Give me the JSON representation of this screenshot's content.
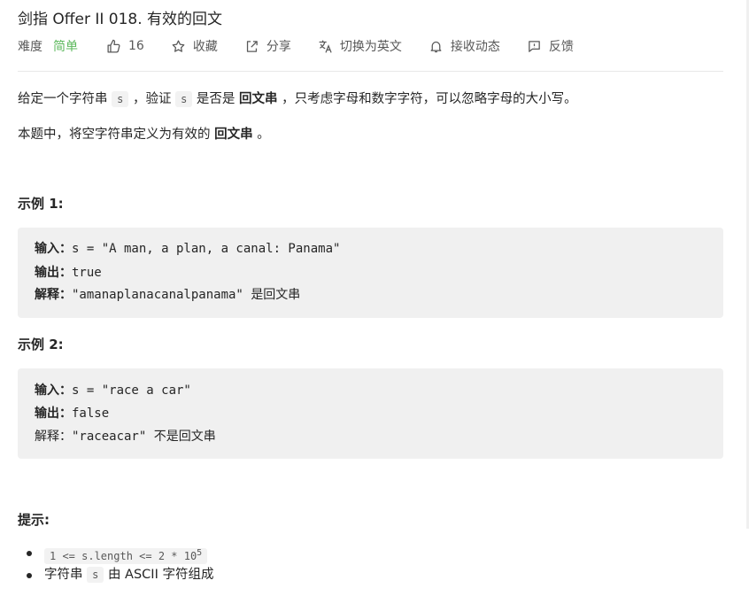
{
  "problem": {
    "title": "剑指 Offer II 018. 有效的回文",
    "difficulty_label": "难度",
    "difficulty": "简单",
    "likes": "16",
    "favorite_label": "收藏",
    "share_label": "分享",
    "switch_lang_label": "切换为英文",
    "notify_label": "接收动态",
    "feedback_label": "反馈"
  },
  "description": {
    "p1_a": "给定一个字符串",
    "p1_code1": "s",
    "p1_b": "，验证",
    "p1_code2": "s",
    "p1_c": "是否是",
    "p1_bold": "回文串",
    "p1_d": "，只考虑字母和数字字符，可以忽略字母的大小写。",
    "p2_a": "本题中，将空字符串定义为有效的",
    "p2_bold": "回文串",
    "p2_b": "。"
  },
  "examples": [
    {
      "heading": "示例 1:",
      "input_label": "输入：",
      "input": "s = \"A man, a plan, a canal: Panama\"",
      "output_label": "输出：",
      "output": "true",
      "explain_label": "解释：",
      "explain_code": "\"amanaplanacanalpanama\"",
      "explain_text": "是回文串"
    },
    {
      "heading": "示例 2:",
      "input_label": "输入：",
      "input": "s = \"race a car\"",
      "output_label": "输出：",
      "output": "false",
      "explain_label": "解释：",
      "explain_code": "\"raceacar\"",
      "explain_text": "不是回文串"
    }
  ],
  "hints": {
    "heading": "提示:",
    "item1_code": "1 <= s.length <= 2 * 10",
    "item1_exp": "5",
    "item2_a": "字符串",
    "item2_code": "s",
    "item2_b": "由 ASCII 字符组成"
  },
  "icons": {
    "likes": "thumbs-up-icon",
    "favorite": "star-icon",
    "share": "share-icon",
    "switch_lang": "translate-icon",
    "notify": "bell-icon",
    "feedback": "feedback-icon"
  },
  "colors": {
    "difficulty_easy": "#5cb85c",
    "code_bg": "#f0f0f0",
    "text": "#262626",
    "muted": "#595959"
  }
}
